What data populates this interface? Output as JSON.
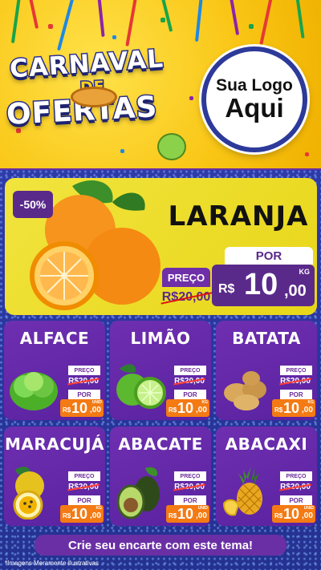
{
  "header": {
    "title_line1": "CARNAVAL",
    "title_line2": "DE",
    "title_line3": "OFERTAS",
    "logo_line1": "Sua Logo",
    "logo_line2": "Aqui"
  },
  "featured": {
    "discount": "-50%",
    "name": "LARANJA",
    "old_label": "PREÇO",
    "old_value": "R$20,00",
    "new_label": "POR",
    "currency": "R$",
    "price_int": "10",
    "price_dec": ",00",
    "unit": "KG"
  },
  "products": [
    {
      "name": "ALFACE",
      "old_label": "PREÇO",
      "old_value": "R$20,00",
      "new_label": "POR",
      "currency": "R$",
      "price_int": "10",
      "price_dec": ",00",
      "unit": "UNID"
    },
    {
      "name": "LIMÃO",
      "old_label": "PREÇO",
      "old_value": "R$20,00",
      "new_label": "POR",
      "currency": "R$",
      "price_int": "10",
      "price_dec": ",00",
      "unit": "KG"
    },
    {
      "name": "BATATA",
      "old_label": "PREÇO",
      "old_value": "R$20,00",
      "new_label": "POR",
      "currency": "R$",
      "price_int": "10",
      "price_dec": ",00",
      "unit": "KG"
    },
    {
      "name": "MARACUJÁ",
      "old_label": "PREÇO",
      "old_value": "R$20,00",
      "new_label": "POR",
      "currency": "R$",
      "price_int": "10",
      "price_dec": ",00",
      "unit": "KG"
    },
    {
      "name": "ABACATE",
      "old_label": "PREÇO",
      "old_value": "R$20,00",
      "new_label": "POR",
      "currency": "R$",
      "price_int": "10",
      "price_dec": ",00",
      "unit": "UNID"
    },
    {
      "name": "ABACAXI",
      "old_label": "PREÇO",
      "old_value": "R$20,00",
      "new_label": "POR",
      "currency": "R$",
      "price_int": "10",
      "price_dec": ",00",
      "unit": "UNID"
    }
  ],
  "cta": "Crie seu encarte com este tema!",
  "disclaimer": "*Imagens Meramente Ilustrativas",
  "colors": {
    "header_yellow": "#f9c514",
    "title_navy": "#2a2f8f",
    "purple": "#6a2fa5",
    "orange_price": "#f47a13",
    "featured_yellow": "#ece03a",
    "blue_bg": "#2f3aa8"
  },
  "icons": [
    "orange-fruit-icon",
    "lettuce-icon",
    "lime-icon",
    "potato-icon",
    "passion-fruit-icon",
    "avocado-icon",
    "pineapple-icon",
    "tambourine-icon",
    "coconut-drink-icon"
  ]
}
